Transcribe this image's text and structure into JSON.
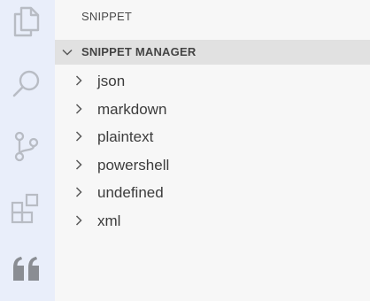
{
  "activity_bar": {
    "icons": [
      "explorer-icon",
      "search-icon",
      "source-control-icon",
      "extensions-icon",
      "snippet-quote-icon"
    ]
  },
  "sidebar": {
    "title": "SNIPPET",
    "section": {
      "title": "SNIPPET MANAGER",
      "expanded": true
    },
    "items": [
      {
        "label": "json"
      },
      {
        "label": "markdown"
      },
      {
        "label": "plaintext"
      },
      {
        "label": "powershell"
      },
      {
        "label": "undefined"
      },
      {
        "label": "xml"
      }
    ]
  },
  "colors": {
    "activity_bar_bg": "#e9eefa",
    "sidebar_bg": "#f7f7f7",
    "section_header_bg": "#e1e1e1",
    "icon_gray": "#b8bcc4",
    "active_icon": "#8a8d93"
  }
}
